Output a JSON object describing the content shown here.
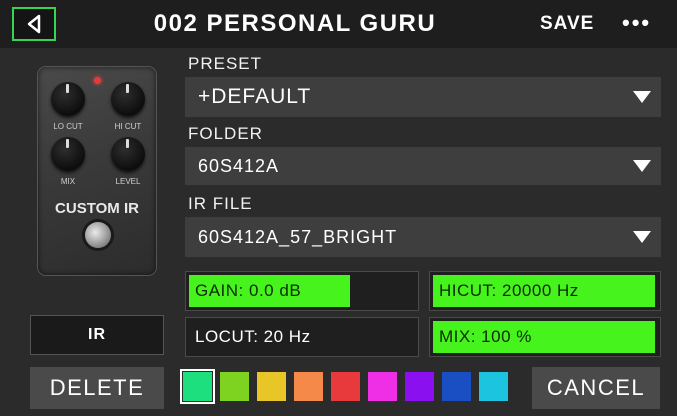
{
  "header": {
    "title": "002 PERSONAL GURU",
    "save_label": "SAVE",
    "more_label": "•••",
    "back_icon": "back-arrow-icon",
    "accent": "#39d353"
  },
  "pedal": {
    "knob_labels": [
      "LO CUT",
      "HI CUT",
      "MIX",
      "LEVEL"
    ],
    "name": "CUSTOM IR"
  },
  "preset": {
    "label": "PRESET",
    "value": "+DEFAULT"
  },
  "folder": {
    "label": "FOLDER",
    "value": "60S412A"
  },
  "ir_file": {
    "label": "IR FILE",
    "value": "60S412A_57_BRIGHT"
  },
  "params": {
    "gain": {
      "text": "GAIN: 0.0 dB",
      "fill_fraction": 0.72
    },
    "hicut": {
      "text": "HICUT: 20000 Hz",
      "fill_fraction": 1.0
    },
    "locut": {
      "text": "LOCUT: 20 Hz",
      "fill_fraction": 0.0
    },
    "mix": {
      "text": "MIX: 100 %",
      "fill_fraction": 1.0
    },
    "fill_color": "#46f31d"
  },
  "ir_button": "IR",
  "delete_label": "DELETE",
  "cancel_label": "CANCEL",
  "swatches": [
    {
      "name": "green",
      "color": "#1ddf7d",
      "selected": true
    },
    {
      "name": "lime",
      "color": "#7ed321"
    },
    {
      "name": "yellow",
      "color": "#e8c628"
    },
    {
      "name": "orange",
      "color": "#f5894a"
    },
    {
      "name": "red",
      "color": "#e8393c"
    },
    {
      "name": "magenta",
      "color": "#ee2fe5"
    },
    {
      "name": "purple",
      "color": "#8a10f0"
    },
    {
      "name": "blue",
      "color": "#1a4fc4"
    },
    {
      "name": "cyan",
      "color": "#1dc4e0"
    }
  ]
}
